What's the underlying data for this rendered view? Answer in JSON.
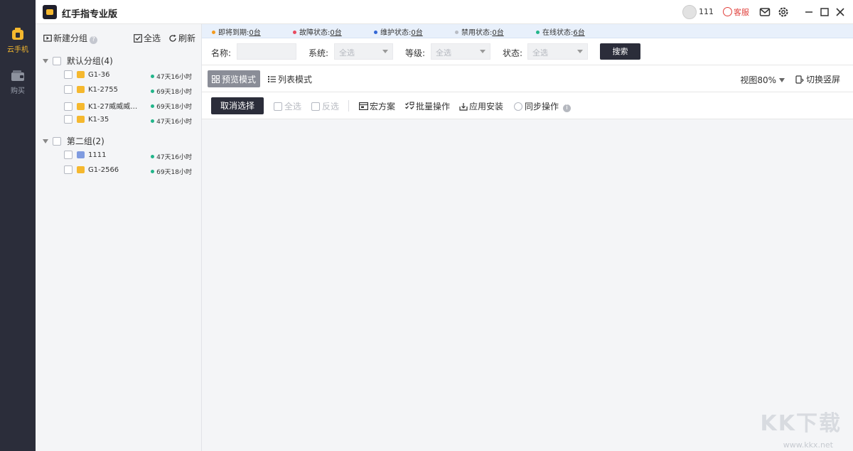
{
  "rail": {
    "items": [
      {
        "label": "云手机",
        "icon": "phone-icon",
        "active": true
      },
      {
        "label": "购买",
        "icon": "wallet-icon",
        "active": false
      }
    ]
  },
  "titlebar": {
    "title": "红手指专业版",
    "user_id": "111",
    "service_label": "客服"
  },
  "sidebar": {
    "new_group": "新建分组",
    "select_all": "全选",
    "refresh": "刷新",
    "groups": [
      {
        "name": "默认分组(4)",
        "devices": [
          {
            "name": "G1-36",
            "time": "47天16小时",
            "icon_color": "#f5b82e"
          },
          {
            "name": "K1-2755",
            "time": "69天18小时",
            "icon_color": "#f5b82e"
          },
          {
            "name": "K1-27威威威威...",
            "time": "69天18小时",
            "icon_color": "#f5b82e"
          },
          {
            "name": "K1-35",
            "time": "47天16小时",
            "icon_color": "#f5b82e"
          }
        ]
      },
      {
        "name": "第二组(2)",
        "devices": [
          {
            "name": "1111",
            "time": "47天16小时",
            "icon_color": "#7f9be0"
          },
          {
            "name": "G1-2566",
            "time": "69天18小时",
            "icon_color": "#f5b82e"
          }
        ]
      }
    ]
  },
  "status": {
    "items": [
      {
        "label": "即将到期:",
        "count": "0台",
        "color": "#f39a1e"
      },
      {
        "label": "故障状态:",
        "count": "0台",
        "color": "#e84a5f"
      },
      {
        "label": "维护状态:",
        "count": "0台",
        "color": "#3367d6"
      },
      {
        "label": "禁用状态:",
        "count": "0台",
        "color": "#b8bcc4"
      },
      {
        "label": "在线状态:",
        "count": "6台",
        "color": "#22b58a"
      }
    ]
  },
  "filters": {
    "name_label": "名称:",
    "system_label": "系统:",
    "system_value": "全选",
    "level_label": "等级:",
    "level_value": "全选",
    "state_label": "状态:",
    "state_value": "全选",
    "search_button": "搜索"
  },
  "modes": {
    "preview": "预览模式",
    "list": "列表模式",
    "zoom": "视图80%",
    "rotate": "切换竖屏"
  },
  "actions": {
    "cancel_select": "取消选择",
    "select_all": "全选",
    "invert": "反选",
    "macro": "宏方案",
    "batch": "批量操作",
    "install": "应用安装",
    "sync": "同步操作"
  },
  "watermark": {
    "text": "KK下载",
    "url": "www.kkx.net"
  }
}
